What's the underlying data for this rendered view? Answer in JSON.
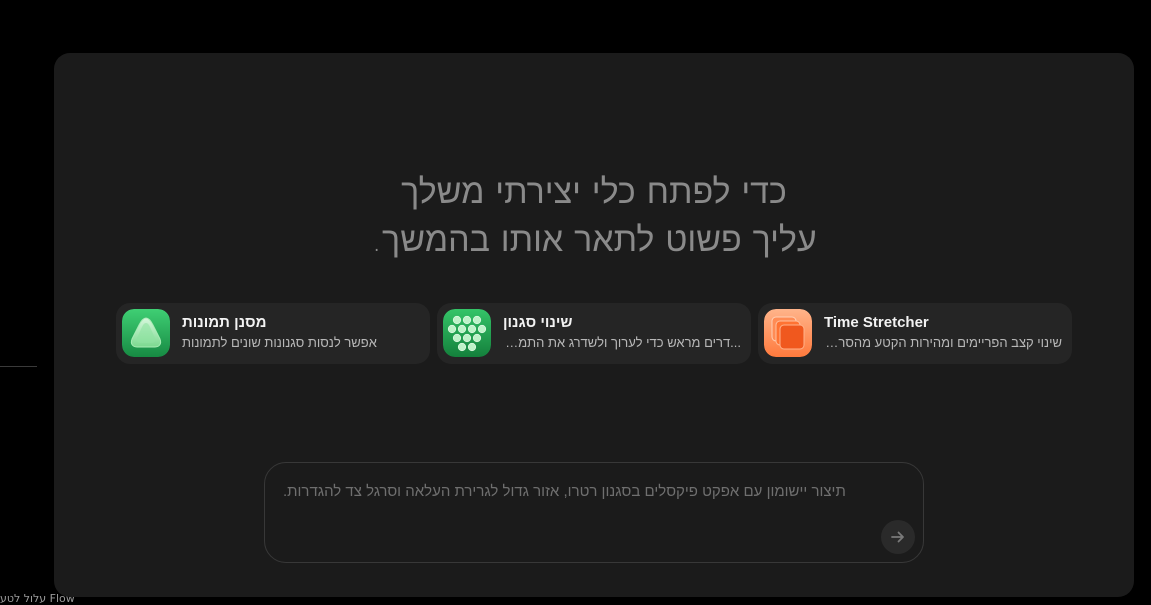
{
  "sidebar": {
    "bottom_label": "Flow עלול לטע"
  },
  "hero": {
    "line1": "כדי לפתח כלי יצירתי משלך",
    "line2": "עליך פשוט לתאר אותו בהמשך."
  },
  "cards": [
    {
      "title": "מסנן תמונות",
      "description": "אפשר לנסות סגנונות שונים לתמונות",
      "icon": "green-triangle-icon"
    },
    {
      "title": "שינוי סגנון",
      "description": "...דרים מראש כדי לערוך ולשדרג את התמונה",
      "icon": "green-dots-icon"
    },
    {
      "title": "Time Stretcher",
      "description": "שינוי קצב הפריימים ומהירות הקטע מהסרטון",
      "icon": "orange-stack-icon"
    }
  ],
  "prompt": {
    "placeholder": "תיצור יישומון עם אפקט פיקסלים בסגנון רטרו, אזור גדול לגרירת העלאה וסרגל צד להגדרות.",
    "value": "",
    "send_icon": "arrow-right-icon"
  },
  "colors": {
    "background": "#000000",
    "panel": "#1b1b1b",
    "card": "#252525",
    "hero_text": "#8a8a8a",
    "accent_green": "#3fbf6a",
    "accent_orange": "#ff6a2a"
  }
}
